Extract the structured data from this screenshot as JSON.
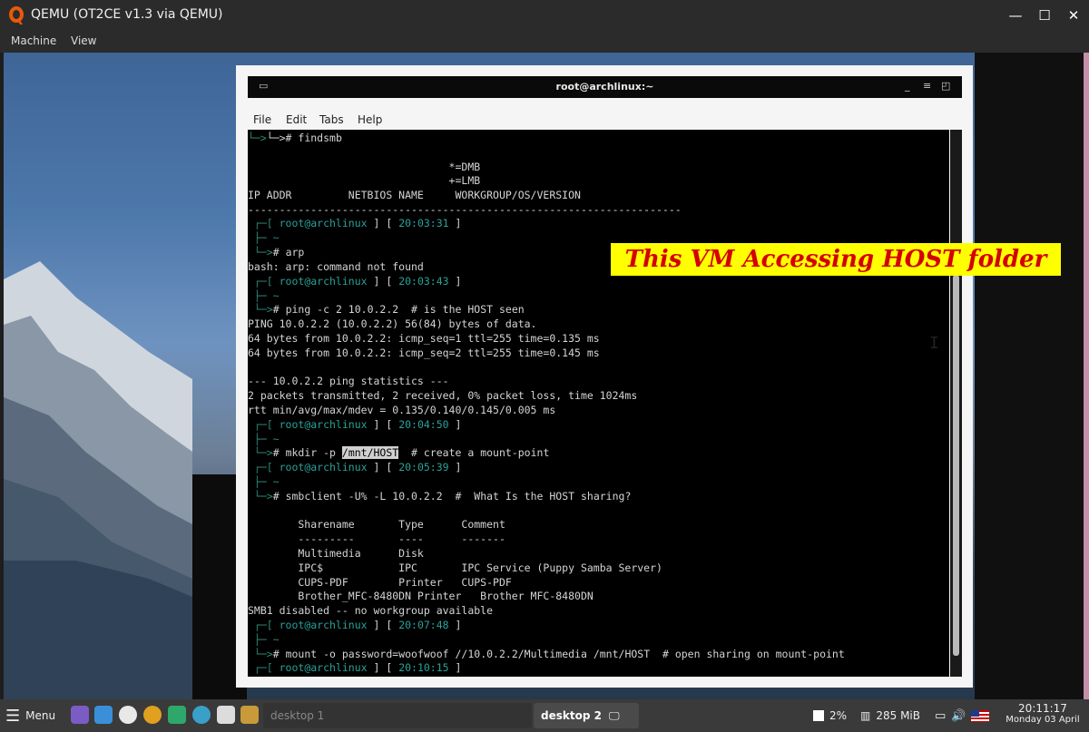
{
  "window": {
    "title": "QEMU (OT2CE v1.3 via QEMU)",
    "minimize": "—",
    "maximize": "☐",
    "close": "✕"
  },
  "menubar": [
    "Machine",
    "View"
  ],
  "terminal": {
    "title": "root@archlinux:~",
    "menu": [
      "File",
      "Edit",
      "Tabs",
      "Help"
    ]
  },
  "annotation": "This VM Accessing HOST folder",
  "lines": {
    "l00": "└─># findsmb",
    "l02": "                                *=DMB",
    "l03": "                                +=LMB",
    "l04": "IP ADDR         NETBIOS NAME     WORKGROUP/OS/VERSION",
    "l05": "---------------------------------------------------------------------",
    "p1_user": "root@archlinux",
    "p1_time": "20:03:31",
    "l08_cmd": " arp",
    "l09": "bash: arp: command not found",
    "p2_user": "root@archlinux",
    "p2_time": "20:03:43",
    "l12_cmd": " ping -c 2 10.0.2.2  # is the HOST seen",
    "l13": "PING 10.0.2.2 (10.0.2.2) 56(84) bytes of data.",
    "l14": "64 bytes from 10.0.2.2: icmp_seq=1 ttl=255 time=0.135 ms",
    "l15": "64 bytes from 10.0.2.2: icmp_seq=2 ttl=255 time=0.145 ms",
    "l17": "--- 10.0.2.2 ping statistics ---",
    "l18": "2 packets transmitted, 2 received, 0% packet loss, time 1024ms",
    "l19": "rtt min/avg/max/mdev = 0.135/0.140/0.145/0.005 ms",
    "p3_user": "root@archlinux",
    "p3_time": "20:04:50",
    "l22_cmd_a": " mkdir -p ",
    "l22_hl": "/mnt/HOST",
    "l22_cmd_b": "  # create a mount-point",
    "p4_user": "root@archlinux",
    "p4_time": "20:05:39",
    "l25_cmd": " smbclient -U% -L 10.0.2.2  #  What Is the HOST sharing?",
    "l27": "        Sharename       Type      Comment",
    "l28": "        ---------       ----      -------",
    "l29": "        Multimedia      Disk",
    "l30": "        IPC$            IPC       IPC Service (Puppy Samba Server)",
    "l31": "        CUPS-PDF        Printer   CUPS-PDF",
    "l32": "        Brother_MFC-8480DN Printer   Brother MFC-8480DN",
    "l33": "SMB1 disabled -- no workgroup available",
    "p5_user": "root@archlinux",
    "p5_time": "20:07:48",
    "l36_cmd": " mount -o password=woofwoof //10.0.2.2/Multimedia /mnt/HOST  # open sharing on mount-point",
    "p6_user": "root@archlinux",
    "p6_time": "20:10:15"
  },
  "taskbar": {
    "menu_label": "Menu",
    "desktop1": "desktop 1",
    "desktop2": "desktop 2",
    "cpu": "2%",
    "mem": "285 MiB",
    "time": "20:11:17",
    "date": "Monday 03 April"
  },
  "colors": {
    "prompt": "#2e8b79",
    "annotation_bg": "#ffff00",
    "annotation_text": "#d40000"
  }
}
